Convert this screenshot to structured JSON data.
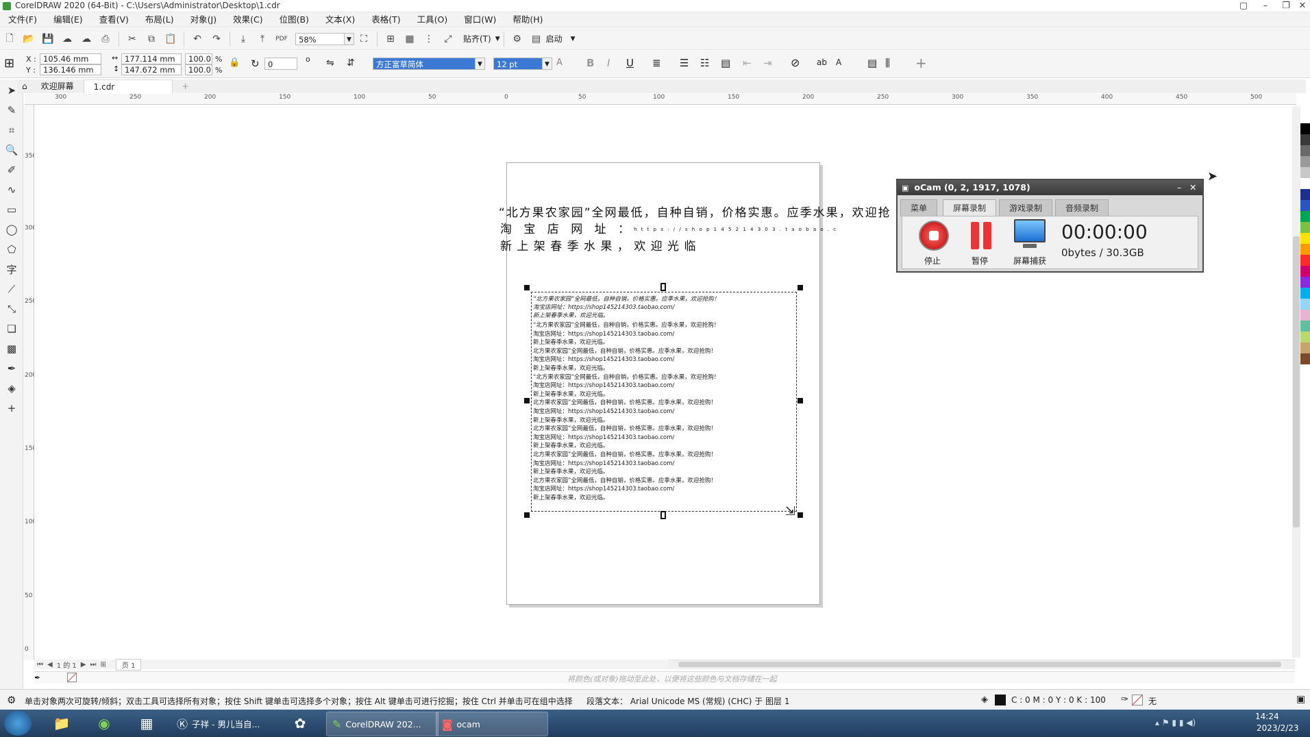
{
  "window": {
    "title": "CorelDRAW 2020 (64-Bit) - C:\\Users\\Administrator\\Desktop\\1.cdr"
  },
  "menubar": [
    "文件(F)",
    "编辑(E)",
    "查看(V)",
    "布局(L)",
    "对象(J)",
    "效果(C)",
    "位图(B)",
    "文本(X)",
    "表格(T)",
    "工具(O)",
    "窗口(W)",
    "帮助(H)"
  ],
  "toolbar1": {
    "zoom": "58%",
    "snap_label": "贴齐(T)",
    "launch_label": "启动"
  },
  "toolbar2": {
    "x_label": "X :",
    "y_label": "Y :",
    "x": "105.46 mm",
    "y": "136.146 mm",
    "w": "177.114 mm",
    "h": "147.672 mm",
    "scale_w": "100.0",
    "scale_h": "100.0",
    "percent": "%",
    "rotation": "0",
    "degree": "o",
    "font": "方正富草简体",
    "size": "12 pt"
  },
  "tabs": {
    "welcome": "欢迎屏幕",
    "doc": "1.cdr"
  },
  "ruler_top": [
    "300",
    "250",
    "200",
    "150",
    "100",
    "50",
    "0",
    "50",
    "100",
    "150",
    "200",
    "250",
    "300",
    "350",
    "400",
    "450",
    "500"
  ],
  "ruler_left": [
    "350",
    "300",
    "250",
    "200",
    "150",
    "100",
    "50",
    "0"
  ],
  "artistic_text": {
    "line1": "“北方果农家园”全网最低，自种自销，价格实惠。应季水果，欢迎抢",
    "line2": "淘 宝 店 网 址 ：",
    "line2_url": "h t t p s : / / s h o p 1 4 5 2 1 4 3 0 3 . t a o b a o . c",
    "line3": "新  上  架  春  季  水  果  ，  欢  迎  光  临"
  },
  "paragraph_text": {
    "header": [
      "“北方果农家园”全网最低，自种自销，价格实惠。应季水果，欢迎抢购！",
      "淘宝店网址：https://shop145214303.taobao.com/",
      "新上架春季水果，欢迎光临。"
    ],
    "repeat": [
      "“北方果农家园”全网最低，自种自销，价格实惠。应季水果，欢迎抢购！",
      "淘宝店网址：https://shop145214303.taobao.com/",
      "新上架春季水果，欢迎光临。",
      "北方果农家园”全网最低，自种自销，价格实惠。应季水果，欢迎抢购！",
      "淘宝店网址：https://shop145214303.taobao.com/",
      "新上架春季水果，欢迎光临。",
      "“北方果农家园”全网最低，自种自销，价格实惠。应季水果，欢迎抢购！",
      "淘宝店网址：https://shop145214303.taobao.com/",
      "新上架春季水果，欢迎光临。",
      "北方果农家园”全网最低，自种自销，价格实惠。应季水果，欢迎抢购！",
      "淘宝店网址：https://shop145214303.taobao.com/",
      "新上架春季水果，欢迎光临。",
      "北方果农家园”全网最低，自种自销，价格实惠。应季水果，欢迎抢购！",
      "淘宝店网址：https://shop145214303.taobao.com/",
      "新上架春季水果，欢迎光临。",
      "北方果农家园”全网最低，自种自销，价格实惠。应季水果，欢迎抢购！",
      "淘宝店网址：https://shop145214303.taobao.com/",
      "新上架春季水果，欢迎光临。",
      "北方果农家园”全网最低，自种自销，价格实惠。应季水果，欢迎抢购！",
      "淘宝店网址：https://shop145214303.taobao.com/",
      "新上架春季水果，欢迎光临。"
    ]
  },
  "pagenav": {
    "counter": "1 的 1",
    "page_tab": "页 1"
  },
  "color_hint": "将颜色(或对象)拖动至此处，以便将这些颜色与文档存储在一起",
  "statusbar": {
    "hint": "单击对象两次可旋转/倾斜；双击工具可选择所有对象；按住 Shift 键单击可选择多个对象；按住 Alt 键单击可进行挖掘；按住 Ctrl 并单击可在组中选择",
    "object": "段落文本： Arial Unicode MS (常规) (CHC) 于 图层 1",
    "fill": "C : 0 M : 0 Y : 0 K : 100",
    "outline": "无"
  },
  "ocam": {
    "title": "oCam (0, 2, 1917, 1078)",
    "tabs": [
      "菜单",
      "屏幕录制",
      "游戏录制",
      "音频录制"
    ],
    "stop": "停止",
    "pause": "暂停",
    "capture": "屏幕捕获",
    "time": "00:00:00",
    "size": "0bytes / 30.3GB"
  },
  "taskbar": {
    "items": [
      "子祥 - 男儿当自...",
      "CorelDRAW 202...",
      "ocam"
    ],
    "time": "14:24",
    "date": "2023/2/23"
  },
  "palette": [
    "#000000",
    "#3a3a3a",
    "#6a6a6a",
    "#9a9a9a",
    "#c8c8c8",
    "#ffffff",
    "#1e2f8f",
    "#2a56c4",
    "#00a651",
    "#7bc143",
    "#ffe100",
    "#ff9900",
    "#ff2a2a",
    "#d0006f",
    "#8a2be2",
    "#00aeef",
    "#93d5f5",
    "#e8b4d0",
    "#5fbf9f",
    "#b7d96e",
    "#caa36a",
    "#7a4a2a"
  ]
}
